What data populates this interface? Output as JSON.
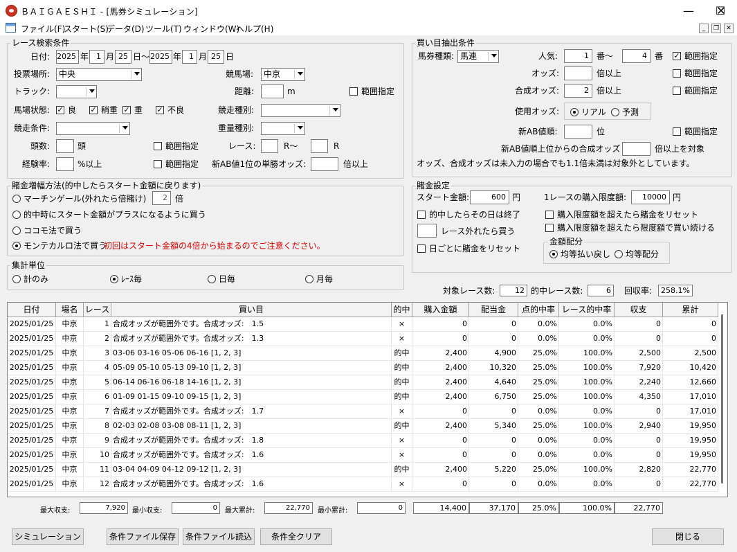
{
  "window": {
    "title": "ＢＡＩＧＡＥＳＨＩ - [馬券シミュレーション]",
    "minimize": "—",
    "maximize": "☐",
    "close": "✕"
  },
  "menu": [
    "ファイル(F)",
    "スタート(S)",
    "データ(D)",
    "ツール(T)",
    "ウィンドウ(W)",
    "ヘルプ(H)"
  ],
  "mdi": {
    "min": "_",
    "restore": "❐",
    "close": "✕"
  },
  "race_search": {
    "title": "レース検索条件",
    "date_label": "日付:",
    "from_year": "2025",
    "from_month": "1",
    "from_day": "25",
    "to_year": "2025",
    "to_month": "1",
    "to_day": "25",
    "year_unit": "年",
    "month_unit": "月",
    "day_unit": "日",
    "range_sep": "日〜",
    "venue_label": "投票場所:",
    "venue": "中央",
    "course_label": "競馬場:",
    "course": "中京",
    "track_label": "トラック:",
    "track": "",
    "distance_label": "距離:",
    "distance": "",
    "distance_unit": "m",
    "distance_range": "範囲指定",
    "cond_label": "馬場状態:",
    "cond_good": "良",
    "cond_slight": "稍重",
    "cond_heavy": "重",
    "cond_bad": "不良",
    "race_type_label": "競走種別:",
    "race_type": "",
    "race_cond_label": "競走条件:",
    "race_cond": "",
    "weight_label": "重量種別:",
    "weight": "",
    "head_label": "頭数:",
    "head": "",
    "head_unit": "頭",
    "head_range": "範囲指定",
    "race_label": "レース:",
    "race_from": "",
    "race_mid": "R〜",
    "race_to": "",
    "race_unit": "R",
    "exp_label": "経験率:",
    "exp": "",
    "exp_unit": "%以上",
    "exp_range": "範囲指定",
    "ab_label": "新AB値1位の単勝オッズ:",
    "ab": "",
    "ab_unit": "倍以上"
  },
  "buy_cond": {
    "title": "買い目抽出条件",
    "type_label": "馬券種類:",
    "type": "馬連",
    "pop_label": "人気:",
    "pop_from": "1",
    "pop_mid": "番〜",
    "pop_to": "4",
    "pop_unit": "番",
    "pop_range": "範囲指定",
    "odds_label": "オッズ:",
    "odds": "",
    "odds_unit": "倍以上",
    "odds_range": "範囲指定",
    "comp_label": "合成オッズ:",
    "comp": "2",
    "comp_unit": "倍以上",
    "comp_range": "範囲指定",
    "use_label": "使用オッズ:",
    "use_real": "リアル",
    "use_pred": "予測",
    "ab_label": "新AB値順:",
    "ab": "",
    "ab_unit": "位",
    "ab_range": "範囲指定",
    "abc_label": "新AB値順上位からの合成オッズ",
    "abc": "",
    "abc_unit": "倍以上を対象",
    "note": "オッズ、合成オッズは未入力の場合でも1.1倍未満は対象外としています。"
  },
  "bet_increase": {
    "title": "賭金増幅方法(的中したらスタート金額に戻ります)",
    "opt1": "マーチンゲール(外れたら倍賭け)",
    "opt1_val": "2",
    "opt1_unit": "倍",
    "opt2": "的中時にスタート金額がプラスになるように買う",
    "opt3": "ココモ法で買う",
    "opt4": "モンテカルロ法で買う",
    "opt4_note": "初回はスタート金額の4倍から始まるのでご注意ください。"
  },
  "bet_setting": {
    "title": "賭金設定",
    "start_label": "スタート金額:",
    "start": "600",
    "start_unit": "円",
    "limit_label": "1レースの購入限度額:",
    "limit": "10000",
    "limit_unit": "円",
    "end_hit": "的中したらその日は終了",
    "reset_limit": "購入限度額を超えたら賭金をリセット",
    "miss_buy": "レース外れたら買う",
    "miss_val": "",
    "cont_limit": "購入限度額を超えたら限度額で買い続ける",
    "reset_day": "日ごとに賭金をリセット",
    "alloc_title": "金額配分",
    "alloc_eq_return": "均等払い戻し",
    "alloc_eq": "均等配分"
  },
  "agg": {
    "title": "集計単位",
    "opt1": "計のみ",
    "opt2": "ﾚｰｽ毎",
    "opt3": "日毎",
    "opt4": "月毎"
  },
  "summary": {
    "races_label": "対象レース数:",
    "races": "12",
    "hits_label": "的中レース数:",
    "hits": "6",
    "rate_label": "回収率:",
    "rate": "258.1%"
  },
  "table": {
    "headers": [
      "日付",
      "場名",
      "レース",
      "買い目",
      "的中",
      "購入金額",
      "配当金",
      "点的中率",
      "レース的中率",
      "収支",
      "累計"
    ],
    "rows": [
      [
        "2025/01/25",
        "中京",
        "1",
        "合成オッズが範囲外です。合成オッズ:　1.5",
        "×",
        "0",
        "0",
        "0.0%",
        "0.0%",
        "0",
        "0"
      ],
      [
        "2025/01/25",
        "中京",
        "2",
        "合成オッズが範囲外です。合成オッズ:　1.3",
        "×",
        "0",
        "0",
        "0.0%",
        "0.0%",
        "0",
        "0"
      ],
      [
        "2025/01/25",
        "中京",
        "3",
        "03-06 03-16 05-06 06-16 [1, 2, 3]",
        "的中",
        "2,400",
        "4,900",
        "25.0%",
        "100.0%",
        "2,500",
        "2,500"
      ],
      [
        "2025/01/25",
        "中京",
        "4",
        "05-09 05-10 05-13 09-10 [1, 2, 3]",
        "的中",
        "2,400",
        "10,320",
        "25.0%",
        "100.0%",
        "7,920",
        "10,420"
      ],
      [
        "2025/01/25",
        "中京",
        "5",
        "06-14 06-16 06-18 14-16 [1, 2, 3]",
        "的中",
        "2,400",
        "4,640",
        "25.0%",
        "100.0%",
        "2,240",
        "12,660"
      ],
      [
        "2025/01/25",
        "中京",
        "6",
        "01-09 01-15 09-10 09-15 [1, 2, 3]",
        "的中",
        "2,400",
        "6,750",
        "25.0%",
        "100.0%",
        "4,350",
        "17,010"
      ],
      [
        "2025/01/25",
        "中京",
        "7",
        "合成オッズが範囲外です。合成オッズ:　1.7",
        "×",
        "0",
        "0",
        "0.0%",
        "0.0%",
        "0",
        "17,010"
      ],
      [
        "2025/01/25",
        "中京",
        "8",
        "02-03 02-08 03-08 08-11 [1, 2, 3]",
        "的中",
        "2,400",
        "5,340",
        "25.0%",
        "100.0%",
        "2,940",
        "19,950"
      ],
      [
        "2025/01/25",
        "中京",
        "9",
        "合成オッズが範囲外です。合成オッズ:　1.8",
        "×",
        "0",
        "0",
        "0.0%",
        "0.0%",
        "0",
        "19,950"
      ],
      [
        "2025/01/25",
        "中京",
        "10",
        "合成オッズが範囲外です。合成オッズ:　1.6",
        "×",
        "0",
        "0",
        "0.0%",
        "0.0%",
        "0",
        "19,950"
      ],
      [
        "2025/01/25",
        "中京",
        "11",
        "03-04 04-09 04-12 09-12 [1, 2, 3]",
        "的中",
        "2,400",
        "5,220",
        "25.0%",
        "100.0%",
        "2,820",
        "22,770"
      ],
      [
        "2025/01/25",
        "中京",
        "12",
        "合成オッズが範囲外です。合成オッズ:　1.6",
        "×",
        "0",
        "0",
        "0.0%",
        "0.0%",
        "0",
        "22,770"
      ]
    ]
  },
  "footer": {
    "max_inc_label": "最大収支:",
    "max_inc": "7,920",
    "min_inc_label": "最小収支:",
    "min_inc": "0",
    "max_cum_label": "最大累計:",
    "max_cum": "22,770",
    "min_cum_label": "最小累計:",
    "min_cum": "0",
    "tot_buy": "14,400",
    "tot_pay": "37,170",
    "tot_pt": "25.0%",
    "tot_race": "100.0%",
    "tot_inc": "22,770"
  },
  "buttons": {
    "sim": "シミュレーション",
    "save": "条件ファイル保存",
    "load": "条件ファイル読込",
    "clear": "条件全クリア",
    "close": "閉じる"
  }
}
